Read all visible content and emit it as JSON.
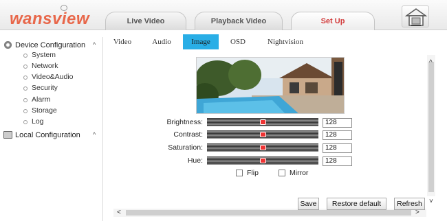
{
  "header": {
    "logo_text": "wansview",
    "tabs": [
      {
        "label": "Live Video",
        "active": false
      },
      {
        "label": "Playback Video",
        "active": false
      },
      {
        "label": "Set Up",
        "active": true
      }
    ],
    "home_icon": "home-icon"
  },
  "sidebar": {
    "device_configuration": {
      "label": "Device Configuration",
      "caret": "^",
      "icon": "gear-icon",
      "items": [
        "System",
        "Network",
        "Video&Audio",
        "Security",
        "Alarm",
        "Storage",
        "Log"
      ]
    },
    "local_configuration": {
      "label": "Local Configuration",
      "caret": "^",
      "icon": "computer-icon"
    }
  },
  "subtabs": [
    {
      "label": "Video",
      "active": false
    },
    {
      "label": "Audio",
      "active": false
    },
    {
      "label": "Image",
      "active": true
    },
    {
      "label": "OSD",
      "active": false
    },
    {
      "label": "Nightvision",
      "active": false
    }
  ],
  "image_settings": {
    "brightness": {
      "label": "Brightness:",
      "value": "128",
      "level": 0.5
    },
    "contrast": {
      "label": "Contrast:",
      "value": "128",
      "level": 0.5
    },
    "saturation": {
      "label": "Saturation:",
      "value": "128",
      "level": 0.5
    },
    "hue": {
      "label": "Hue:",
      "value": "128",
      "level": 0.5
    },
    "flip_label": "Flip",
    "mirror_label": "Mirror",
    "flip_checked": false,
    "mirror_checked": false
  },
  "buttons": {
    "save": "Save",
    "restore_default": "Restore default",
    "refresh": "Refresh"
  },
  "scroll": {
    "up_arrow": "^",
    "down_arrow": "˅",
    "left_arrow": "<",
    "right_arrow": ">"
  },
  "colors": {
    "brand": "#e8674a",
    "active_tab_text": "#d23b3b",
    "active_subtab": "#29aee6",
    "slider_thumb": "#e33333"
  }
}
